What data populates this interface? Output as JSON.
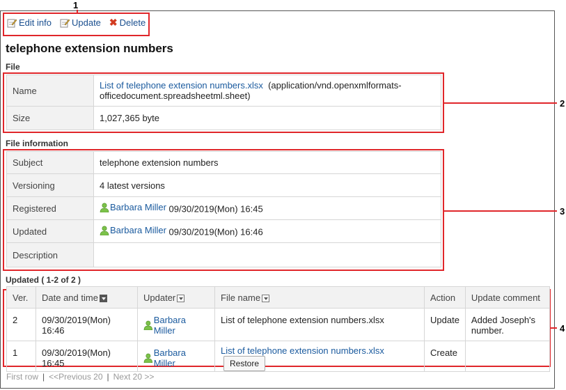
{
  "callouts": {
    "c1": "1",
    "c2": "2",
    "c3": "3",
    "c4": "4"
  },
  "toolbar": {
    "edit_info": "Edit info",
    "update": "Update",
    "delete": "Delete"
  },
  "title": "telephone extension numbers",
  "file_section": {
    "heading": "File",
    "name_label": "Name",
    "file_link": "List of telephone extension numbers.xlsx",
    "mime_line1": "(application/vnd.openxmlformats-",
    "mime_line2": "officedocument.spreadsheetml.sheet)",
    "size_label": "Size",
    "size_value": "1,027,365 byte"
  },
  "info_section": {
    "heading": "File information",
    "subject_label": "Subject",
    "subject_value": "telephone extension numbers",
    "versioning_label": "Versioning",
    "versioning_value": "4  latest versions",
    "registered_label": "Registered",
    "registered_user": "Barbara Miller",
    "registered_time": " 09/30/2019(Mon) 16:45",
    "updated_label": "Updated",
    "updated_user": "Barbara Miller",
    "updated_time": " 09/30/2019(Mon) 16:46",
    "description_label": "Description",
    "description_value": ""
  },
  "history": {
    "heading": "Updated ( 1-2 of 2 )",
    "columns": {
      "ver": "Ver.",
      "date": "Date and time",
      "updater": "Updater",
      "file": "File name",
      "action": "Action",
      "comment": "Update comment"
    },
    "rows": [
      {
        "ver": "2",
        "date": "09/30/2019(Mon) 16:46",
        "updater": "Barbara Miller",
        "file": "List of telephone extension numbers.xlsx",
        "action": "Update",
        "comment": "Added Joseph's number."
      },
      {
        "ver": "1",
        "date": "09/30/2019(Mon) 16:45",
        "updater": "Barbara Miller",
        "file": "List of telephone extension numbers.xlsx",
        "restore": "Restore",
        "action": "Create",
        "comment": ""
      }
    ]
  },
  "pager": {
    "first": "First row",
    "prev": "<<Previous 20",
    "next": "Next 20 >>",
    "sep": "|"
  },
  "colors": {
    "callout_red": "#e0262a",
    "link": "#1a5a9e",
    "user_icon": "#7cc24a"
  }
}
